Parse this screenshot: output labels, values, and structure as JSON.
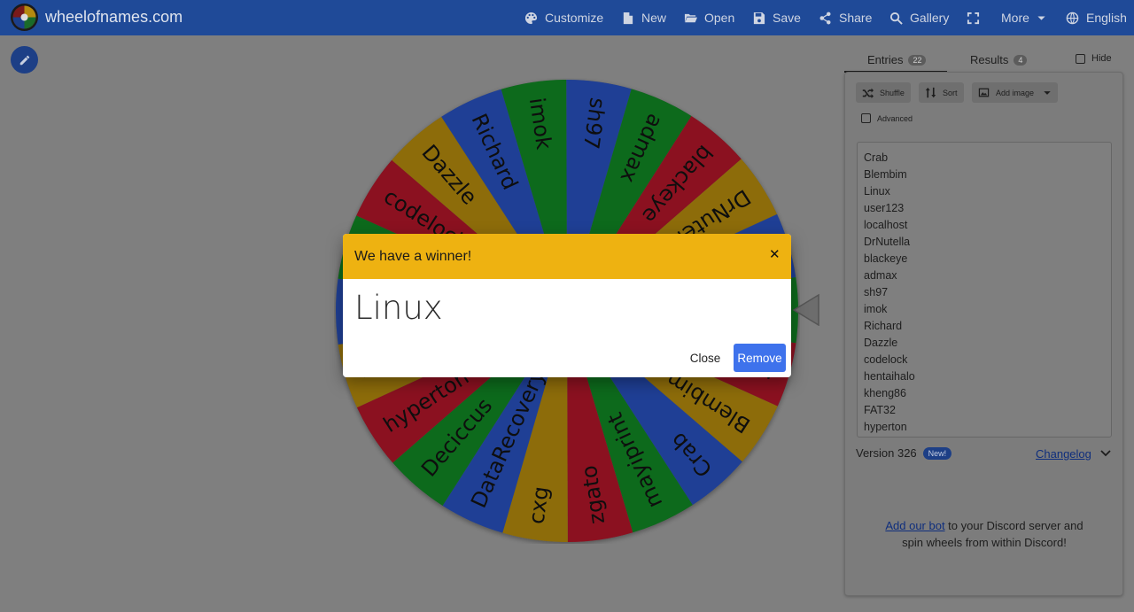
{
  "header": {
    "site_name": "wheelofnames.com",
    "nav": [
      {
        "label": "Customize",
        "icon": "palette-icon"
      },
      {
        "label": "New",
        "icon": "file-icon"
      },
      {
        "label": "Open",
        "icon": "folder-open-icon"
      },
      {
        "label": "Save",
        "icon": "save-icon"
      },
      {
        "label": "Share",
        "icon": "share-icon"
      },
      {
        "label": "Gallery",
        "icon": "search-icon"
      },
      {
        "label": "",
        "icon": "fullscreen-icon"
      },
      {
        "label": "More",
        "icon": "chevron-down-icon"
      },
      {
        "label": "English",
        "icon": "globe-icon"
      }
    ]
  },
  "wheel": {
    "colors": [
      "#1f3f95",
      "#0d6a1c",
      "#8b1120",
      "#8d6c0a"
    ],
    "slices": [
      "sh97",
      "admax",
      "blackeye",
      "DrNutella",
      "localhost",
      "user123",
      "Linux",
      "Blembim",
      "Crab",
      "mayiprint",
      "zgato",
      "cxg",
      "DataRecovery",
      "Deciccus",
      "hyperton",
      "FAT32",
      "kheng86",
      "hentaihalo",
      "codelock",
      "Dazzle",
      "Richard",
      "imok"
    ]
  },
  "tabs": {
    "entries_label": "Entries",
    "entries_count": "22",
    "results_label": "Results",
    "results_count": "4",
    "hide_label": "Hide"
  },
  "toolbar": {
    "shuffle": "Shuffle",
    "sort": "Sort",
    "add_image": "Add image",
    "advanced": "Advanced"
  },
  "entries": [
    "Crab",
    "Blembim",
    "Linux",
    "user123",
    "localhost",
    "DrNutella",
    "blackeye",
    "admax",
    "sh97",
    "imok",
    "Richard",
    "Dazzle",
    "codelock",
    "hentaihalo",
    "kheng86",
    "FAT32",
    "hyperton"
  ],
  "footer": {
    "version": "Version 326",
    "new_badge": "New!",
    "changelog": "Changelog",
    "discord_link": "Add our bot",
    "discord_text": " to your Discord server and spin wheels from within Discord!"
  },
  "modal": {
    "title": "We have a winner!",
    "winner": "Linux",
    "close_label": "Close",
    "remove_label": "Remove"
  }
}
